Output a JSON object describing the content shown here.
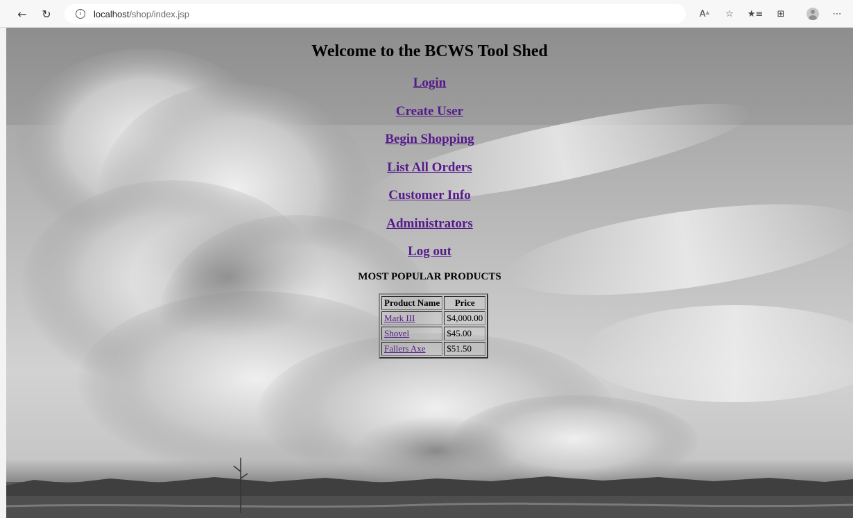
{
  "browser": {
    "url_host": "localhost",
    "url_path": "/shop/index.jsp",
    "icons": [
      "back-icon",
      "refresh-icon",
      "info-icon",
      "read-aloud-icon",
      "favorite-add-icon",
      "favorites-icon",
      "collections-icon",
      "profile-avatar-icon",
      "more-icon"
    ]
  },
  "page": {
    "title": "Welcome to the BCWS Tool Shed",
    "menu": [
      {
        "label": "Login"
      },
      {
        "label": "Create User"
      },
      {
        "label": "Begin Shopping"
      },
      {
        "label": "List All Orders"
      },
      {
        "label": "Customer Info"
      },
      {
        "label": "Administrators"
      },
      {
        "label": "Log out"
      }
    ],
    "popular_heading": "MOST POPULAR PRODUCTS",
    "table": {
      "headers": [
        "Product Name",
        "Price"
      ],
      "rows": [
        {
          "name": "Mark III",
          "price": "$4,000.00"
        },
        {
          "name": "Shovel",
          "price": "$45.00"
        },
        {
          "name": "Fallers Axe",
          "price": "$51.50"
        }
      ]
    }
  },
  "colors": {
    "link_visited": "#551a8b",
    "chrome_bg": "#f7f7f7"
  }
}
